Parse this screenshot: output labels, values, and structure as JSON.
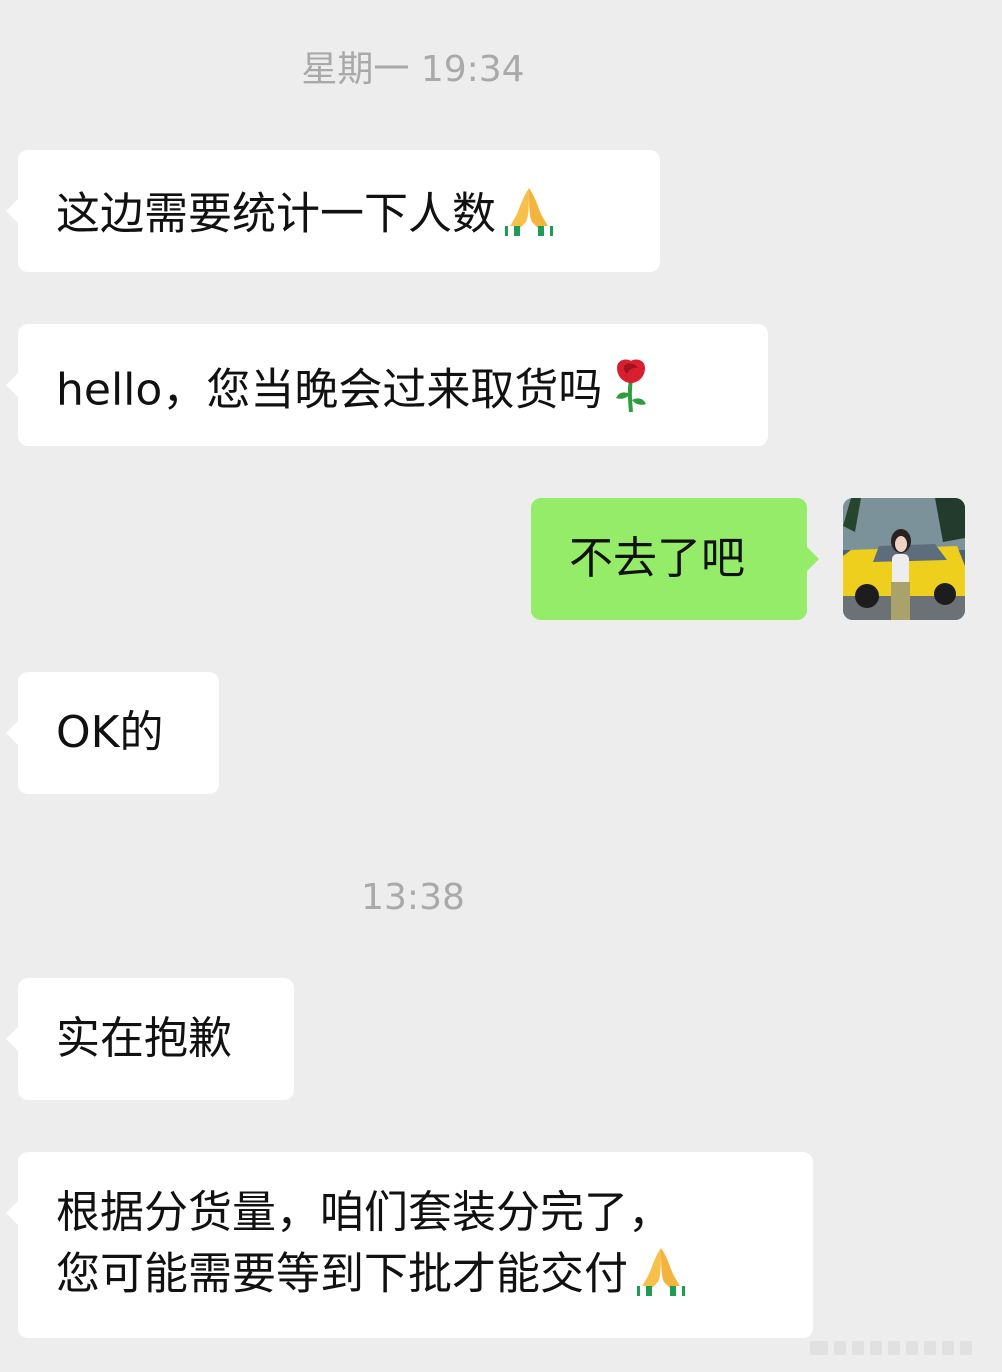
{
  "timestamps": {
    "first": "星期一 19:34",
    "second": "13:38"
  },
  "messages": [
    {
      "side": "left",
      "text": "这边需要统计一下人数",
      "emoji": "folded-hands-icon"
    },
    {
      "side": "left",
      "text": "hello，您当晚会过来取货吗",
      "emoji": "rose-icon"
    },
    {
      "side": "right",
      "text": "不去了吧"
    },
    {
      "side": "left",
      "text": "OK的"
    },
    {
      "side": "left",
      "text": "实在抱歉"
    },
    {
      "side": "left",
      "lines": [
        "根据分货量，咱们套装分完了，",
        "您可能需要等到下批才能交付"
      ],
      "emoji": "folded-hands-icon"
    }
  ],
  "colors": {
    "background": "#ededed",
    "incoming_bubble": "#ffffff",
    "outgoing_bubble": "#95ec69",
    "timestamp_text": "#a9a9a9"
  }
}
